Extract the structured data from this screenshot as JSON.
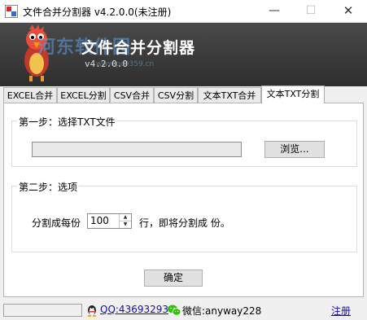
{
  "window": {
    "title": "文件合并分割器 v4.2.0.0(未注册)",
    "minimize_glyph": "—",
    "maximize_glyph": "☐",
    "close_glyph": "✕"
  },
  "banner": {
    "app_name": "文件合并分割器",
    "version": "v4.2.0.0",
    "watermark": "河东软件园",
    "watermark_url": "www.pc0359.cn"
  },
  "tabs": [
    {
      "label": "EXCEL合并",
      "active": false
    },
    {
      "label": "EXCEL分割",
      "active": false
    },
    {
      "label": "CSV合并",
      "active": false
    },
    {
      "label": "CSV分割",
      "active": false
    },
    {
      "label": "文本TXT合并",
      "active": false
    },
    {
      "label": "文本TXT分割",
      "active": true
    }
  ],
  "step1": {
    "legend": "第一步：选择TXT文件",
    "file_path": "",
    "browse_label": "浏览..."
  },
  "step2": {
    "legend": "第二步：选项",
    "split_label": "分割成每份",
    "split_value": "100",
    "unit_label": "行，即将分割成 份。",
    "spin_up": "▲",
    "spin_down": "▼"
  },
  "confirm_label": "确定",
  "statusbar": {
    "status_text": "",
    "qq": "QQ:43693293",
    "wechat": "微信:anyway228",
    "register": "注册"
  },
  "icons": [
    "app-icon",
    "minimize-icon",
    "maximize-icon",
    "close-icon",
    "mascot-logo",
    "qq-icon",
    "wechat-icon"
  ]
}
